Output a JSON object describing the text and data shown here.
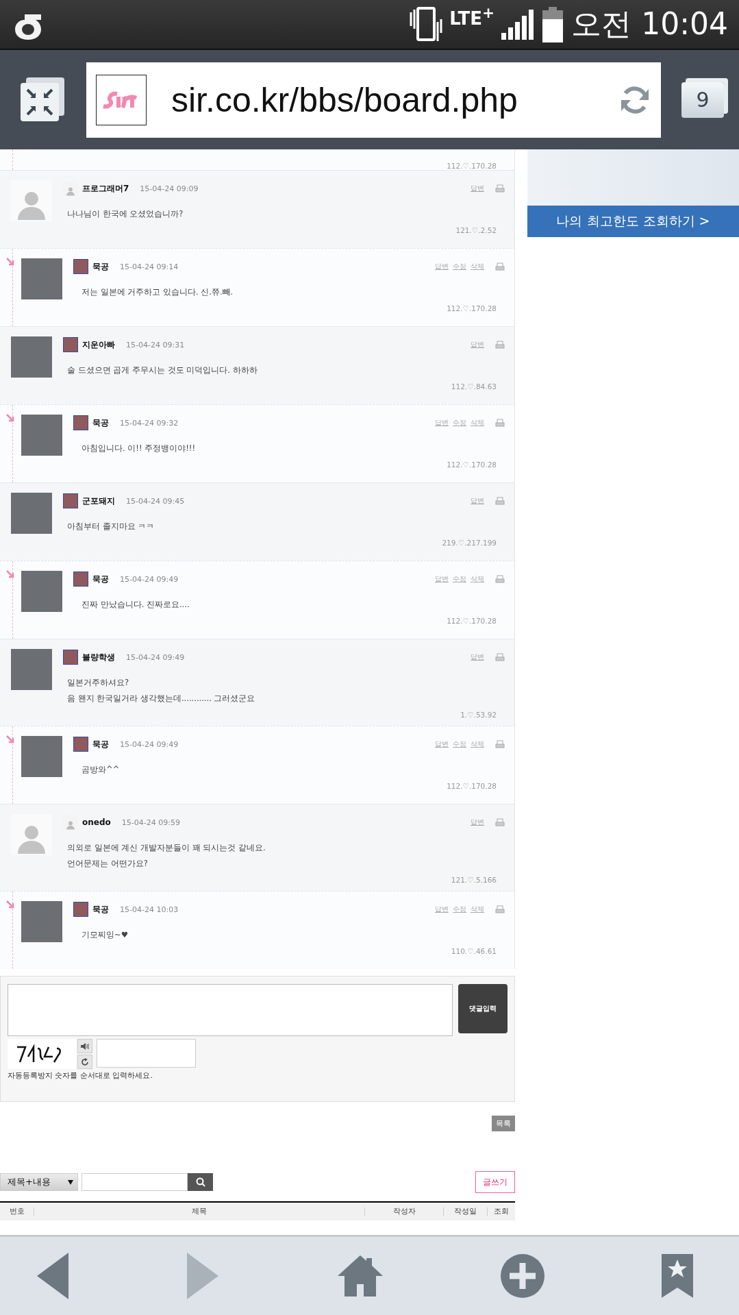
{
  "status_bar": {
    "network": "LTE$^{+}$",
    "time": "오전 10:04"
  },
  "browser_bar": {
    "url": "sir.co.kr/bbs/board.php",
    "tab_count": "9"
  },
  "partial_comment": {
    "ip": "112.♡.170.28",
    "reply": true
  },
  "comments": [
    {
      "reply": false,
      "avatar": {
        "kind": "silhouette"
      },
      "badge": {
        "kind": "silhouette"
      },
      "name": "프로그래머7",
      "date": "15-04-24 09:09",
      "actions": [
        "답변"
      ],
      "lines": [
        "나나님이 한국에 오셨었습니까?"
      ],
      "ip": "121.♡.2.52"
    },
    {
      "reply": true,
      "avatar": {
        "kind": "photo"
      },
      "badge": {
        "kind": "image"
      },
      "name": "묵공",
      "date": "15-04-24 09:14",
      "actions": [
        "답변",
        "수정",
        "삭제"
      ],
      "lines": [
        "저는 일본에 거주하고 있습니다. 신.쮸.빼."
      ],
      "ip": "112.♡.170.28"
    },
    {
      "reply": false,
      "avatar": {
        "kind": "photo"
      },
      "badge": {
        "kind": "image"
      },
      "name": "지운아빠",
      "date": "15-04-24 09:31",
      "actions": [
        "답변"
      ],
      "lines": [
        "술 드셨으면 곱게 주무시는 것도 미덕입니다. 하하하"
      ],
      "ip": "112.♡.84.63"
    },
    {
      "reply": true,
      "avatar": {
        "kind": "photo"
      },
      "badge": {
        "kind": "image"
      },
      "name": "묵공",
      "date": "15-04-24 09:32",
      "actions": [
        "답변",
        "수정",
        "삭제"
      ],
      "lines": [
        "아침입니다. 이!! 주정뱅이야!!!"
      ],
      "ip": "112.♡.170.28"
    },
    {
      "reply": false,
      "avatar": {
        "kind": "photo"
      },
      "badge": {
        "kind": "image"
      },
      "name": "군포돼지",
      "date": "15-04-24 09:45",
      "actions": [
        "답변"
      ],
      "lines": [
        "아침부터 졸지마요 ㅋㅋ"
      ],
      "ip": "219.♡.217.199"
    },
    {
      "reply": true,
      "avatar": {
        "kind": "photo"
      },
      "badge": {
        "kind": "image"
      },
      "name": "묵공",
      "date": "15-04-24 09:49",
      "actions": [
        "답변",
        "수정",
        "삭제"
      ],
      "lines": [
        "진짜 만났습니다. 진짜로요...."
      ],
      "ip": "112.♡.170.28"
    },
    {
      "reply": false,
      "avatar": {
        "kind": "photo"
      },
      "badge": {
        "kind": "image"
      },
      "name": "불량학생",
      "date": "15-04-24 09:49",
      "actions": [
        "답변"
      ],
      "lines": [
        "일본거주하셔요?",
        "음 왠지 한국일거라 생각했는데............ 그러셨군요"
      ],
      "ip": "1.♡.53.92"
    },
    {
      "reply": true,
      "avatar": {
        "kind": "photo"
      },
      "badge": {
        "kind": "image"
      },
      "name": "묵공",
      "date": "15-04-24 09:49",
      "actions": [
        "답변",
        "수정",
        "삭제"
      ],
      "lines": [
        "곰방와^^"
      ],
      "ip": "112.♡.170.28"
    },
    {
      "reply": false,
      "avatar": {
        "kind": "silhouette"
      },
      "badge": {
        "kind": "silhouette"
      },
      "name": "onedo",
      "date": "15-04-24 09:59",
      "actions": [
        "답변"
      ],
      "lines": [
        "의외로 일본에 계신 개발자분들이 꽤 되시는것 같네요.",
        "언어문제는 어떤가요?"
      ],
      "ip": "121.♡.5.166"
    },
    {
      "reply": true,
      "avatar": {
        "kind": "photo"
      },
      "badge": {
        "kind": "image"
      },
      "name": "묵공",
      "date": "15-04-24 10:03",
      "actions": [
        "답변",
        "수정",
        "삭제"
      ],
      "lines": [
        "기모찌잉~♥"
      ],
      "ip": "110.♡.46.61"
    }
  ],
  "ad": {
    "text": "나의 최고한도 조회하기 >"
  },
  "comment_form": {
    "submit": "댓글입력",
    "captcha_hint": "자동등록방지 숫자를 순서대로 입력하세요."
  },
  "list_button": "목록",
  "search": {
    "field": "제목+내용",
    "write_button": "글쓰기"
  },
  "table": {
    "columns": [
      "번호",
      "제목",
      "작성자",
      "작성일",
      "조회"
    ]
  },
  "bottom_nav": [
    {
      "kind": "back",
      "disabled": false
    },
    {
      "kind": "forward",
      "disabled": true
    },
    {
      "kind": "home",
      "disabled": false
    },
    {
      "kind": "add",
      "disabled": false
    },
    {
      "kind": "bookmark",
      "disabled": false
    }
  ]
}
